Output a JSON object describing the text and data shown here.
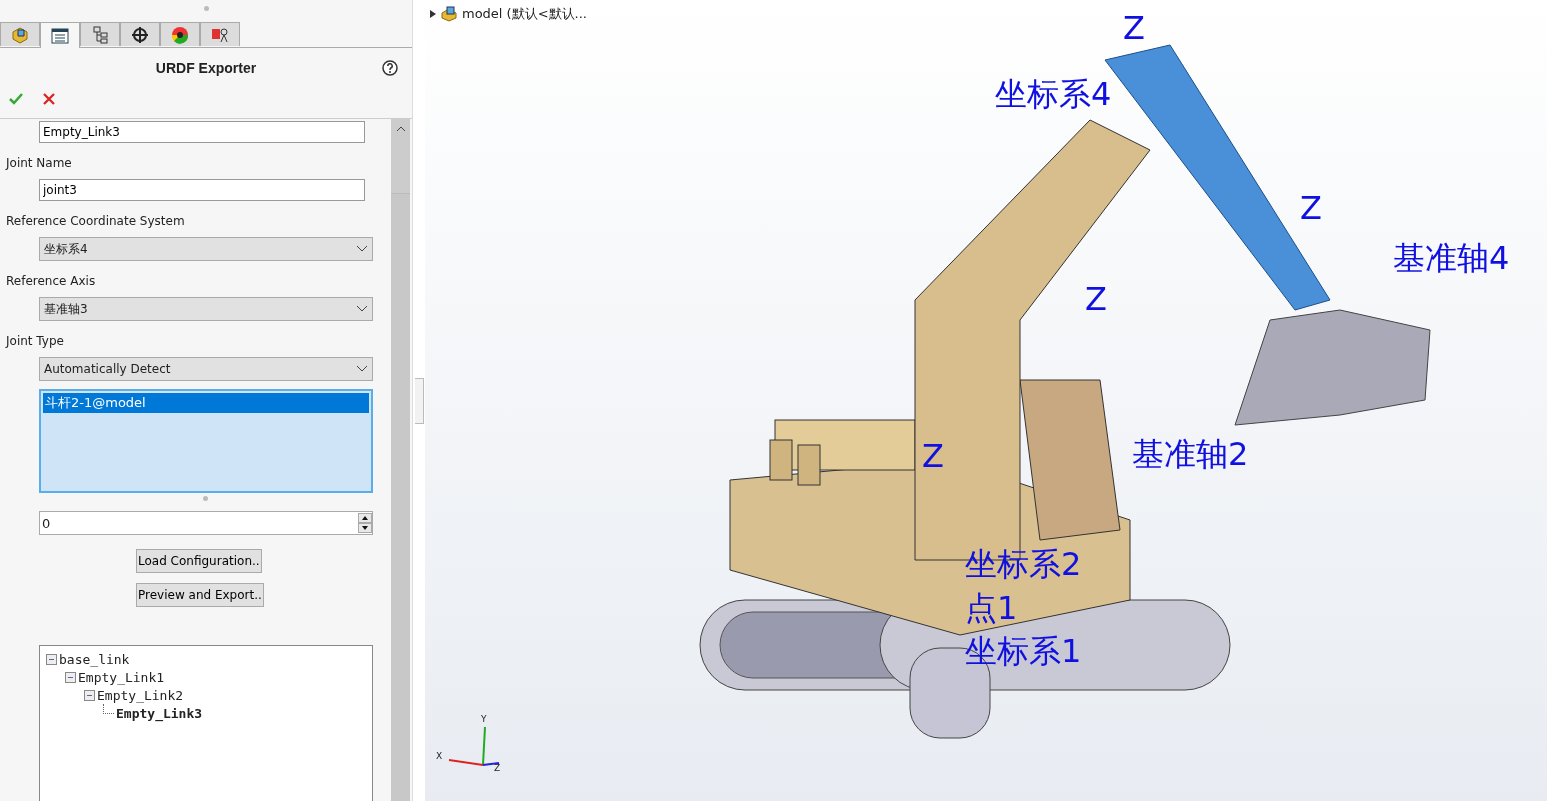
{
  "panel": {
    "tabs": [
      {
        "kind": "part",
        "selected": false
      },
      {
        "kind": "property",
        "selected": true
      },
      {
        "kind": "config",
        "selected": false
      },
      {
        "kind": "target",
        "selected": false
      },
      {
        "kind": "appearance",
        "selected": false
      },
      {
        "kind": "cam",
        "selected": false
      }
    ],
    "title": "URDF Exporter",
    "link_name": "Empty_Link3",
    "fields": [
      {
        "label": "Joint Name",
        "kind": "text",
        "value": "joint3"
      },
      {
        "label": "Reference Coordinate System",
        "kind": "select",
        "value": "坐标系4"
      },
      {
        "label": "Reference Axis",
        "kind": "select",
        "value": "基准轴3"
      },
      {
        "label": "Joint Type",
        "kind": "select",
        "value": "Automatically Detect"
      }
    ],
    "components": [
      {
        "label": "斗杆2-1@model",
        "selected": true
      }
    ],
    "number": "0",
    "buttons": [
      "Load Configuration..",
      "Preview and Export.."
    ],
    "tree": [
      {
        "label": "base_link",
        "selected": false,
        "children": [
          {
            "label": "Empty_Link1",
            "selected": false,
            "children": [
              {
                "label": "Empty_Link2",
                "selected": false,
                "children": [
                  {
                    "label": "Empty_Link3",
                    "selected": true
                  }
                ]
              }
            ]
          }
        ]
      }
    ]
  },
  "viewport": {
    "breadcrumb": "model  (默认<默认...",
    "labels": [
      "Z",
      "坐标系4",
      "Z",
      "基准轴4",
      "Z",
      "基准轴2",
      "Z",
      "坐标系2",
      "点1",
      "坐标系1"
    ],
    "triad": [
      "Y",
      "X",
      "Z"
    ]
  }
}
